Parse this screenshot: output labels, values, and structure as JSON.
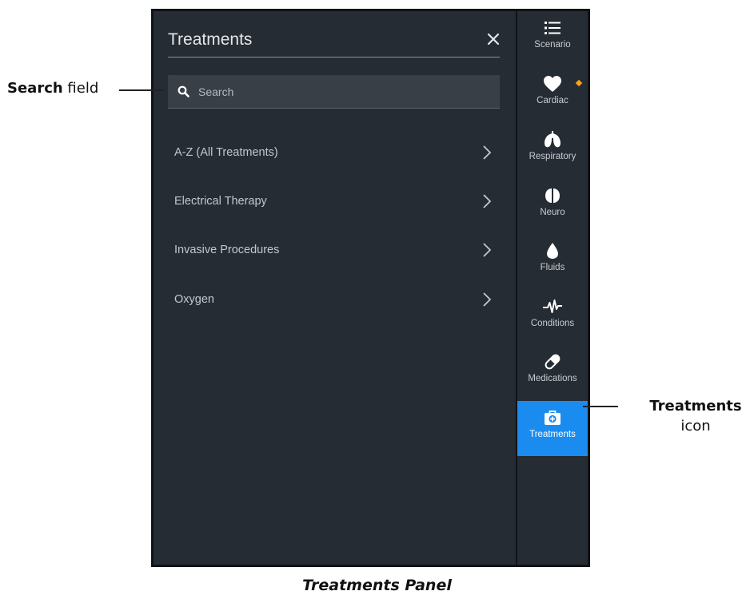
{
  "panel": {
    "title": "Treatments",
    "search": {
      "placeholder": "Search"
    },
    "items": [
      {
        "label": "A-Z (All Treatments)"
      },
      {
        "label": "Electrical Therapy"
      },
      {
        "label": "Invasive Procedures"
      },
      {
        "label": "Oxygen"
      }
    ]
  },
  "rail": {
    "items": [
      {
        "label": "Scenario",
        "icon": "list-icon"
      },
      {
        "label": "Cardiac",
        "icon": "heart-icon",
        "badge_color": "#f2a51a"
      },
      {
        "label": "Respiratory",
        "icon": "lungs-icon"
      },
      {
        "label": "Neuro",
        "icon": "brain-icon"
      },
      {
        "label": "Fluids",
        "icon": "droplet-icon"
      },
      {
        "label": "Conditions",
        "icon": "pulse-icon"
      },
      {
        "label": "Medications",
        "icon": "pill-icon"
      },
      {
        "label": "Treatments",
        "icon": "medical-kit-icon",
        "active": true
      }
    ],
    "active_color": "#1a8cf0"
  },
  "callouts": {
    "search": {
      "bold": "Search",
      "rest": " field"
    },
    "treatments": {
      "bold": "Treatments",
      "rest": "icon"
    }
  },
  "caption": "Treatments Panel"
}
